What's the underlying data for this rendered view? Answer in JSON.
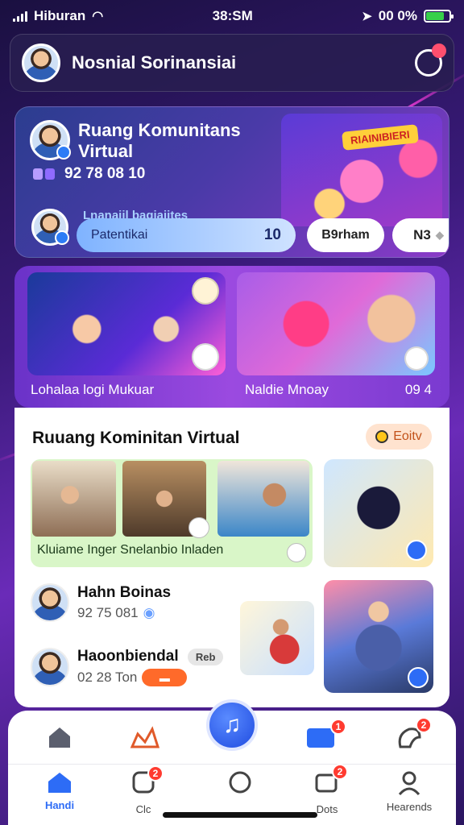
{
  "status": {
    "carrier": "Hiburan",
    "time": "38:SM",
    "battery": "00 0%",
    "battery_level": 0.8
  },
  "header": {
    "title": "Nosnial Sorinansiai"
  },
  "community": {
    "title": "Ruang Komunitans Virtual",
    "stats": "92 78 08 10",
    "sign": "RIAINIBIERI",
    "pill_overlay": "Lnanaiil bagiaiites",
    "pill_label": "Patentikai",
    "pill_value": "10",
    "btn_b": "B9rham",
    "btn_c": "N3"
  },
  "features": {
    "caption_1": "Lohalaa logi Mukuar",
    "caption_2": "Naldie Mnoay",
    "caption_3": "09 4"
  },
  "panel": {
    "title": "Ruuang Kominitan Virtual",
    "edit_label": "Eoitv",
    "gallery_caption": "Kluiame Inger Snelanbio Inladen",
    "user_1": {
      "name": "Hahn Boinas",
      "stat": "92 75 081"
    },
    "user_2": {
      "name": "Haoonbiendal",
      "tag": "Reb",
      "stat": "02 28 Ton"
    }
  },
  "nav": {
    "badges": {
      "messages": "1",
      "stickers": "2",
      "tab_2": "2",
      "tab_4": "2"
    },
    "tabs": [
      {
        "label": "Handi",
        "icon": "home-icon"
      },
      {
        "label": "Clc",
        "icon": "sticker-icon"
      },
      {
        "label": "",
        "icon": "chat-bubble-icon"
      },
      {
        "label": "Dots",
        "icon": "cards-icon"
      },
      {
        "label": "Hearends",
        "icon": "profile-icon"
      }
    ]
  },
  "colors": {
    "accent": "#2d6cf6",
    "badge": "#ff3b30",
    "panel_bg": "#ffffff"
  }
}
